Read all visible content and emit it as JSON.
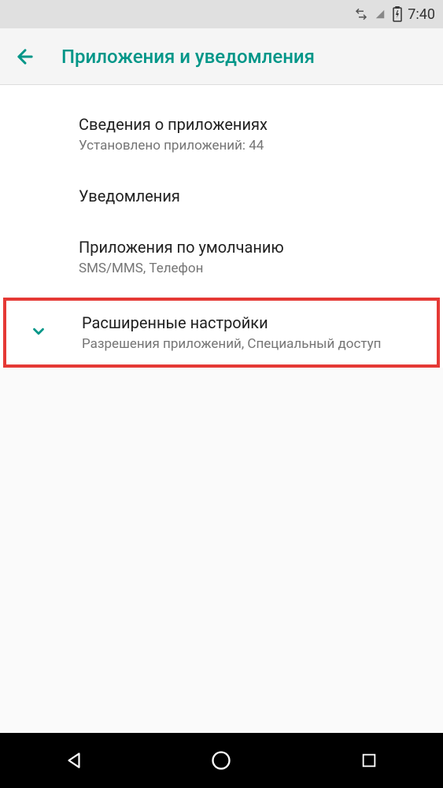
{
  "status_bar": {
    "time": "7:40"
  },
  "app_bar": {
    "title": "Приложения и уведомления"
  },
  "items": [
    {
      "title": "Сведения о приложениях",
      "subtitle": "Установлено приложений: 44"
    },
    {
      "title": "Уведомления",
      "subtitle": ""
    },
    {
      "title": "Приложения по умолчанию",
      "subtitle": "SMS/MMS, Телефон"
    },
    {
      "title": "Расширенные настройки",
      "subtitle": "Разрешения приложений, Специальный доступ"
    }
  ],
  "colors": {
    "accent": "#009688",
    "highlight_border": "#e53935"
  }
}
